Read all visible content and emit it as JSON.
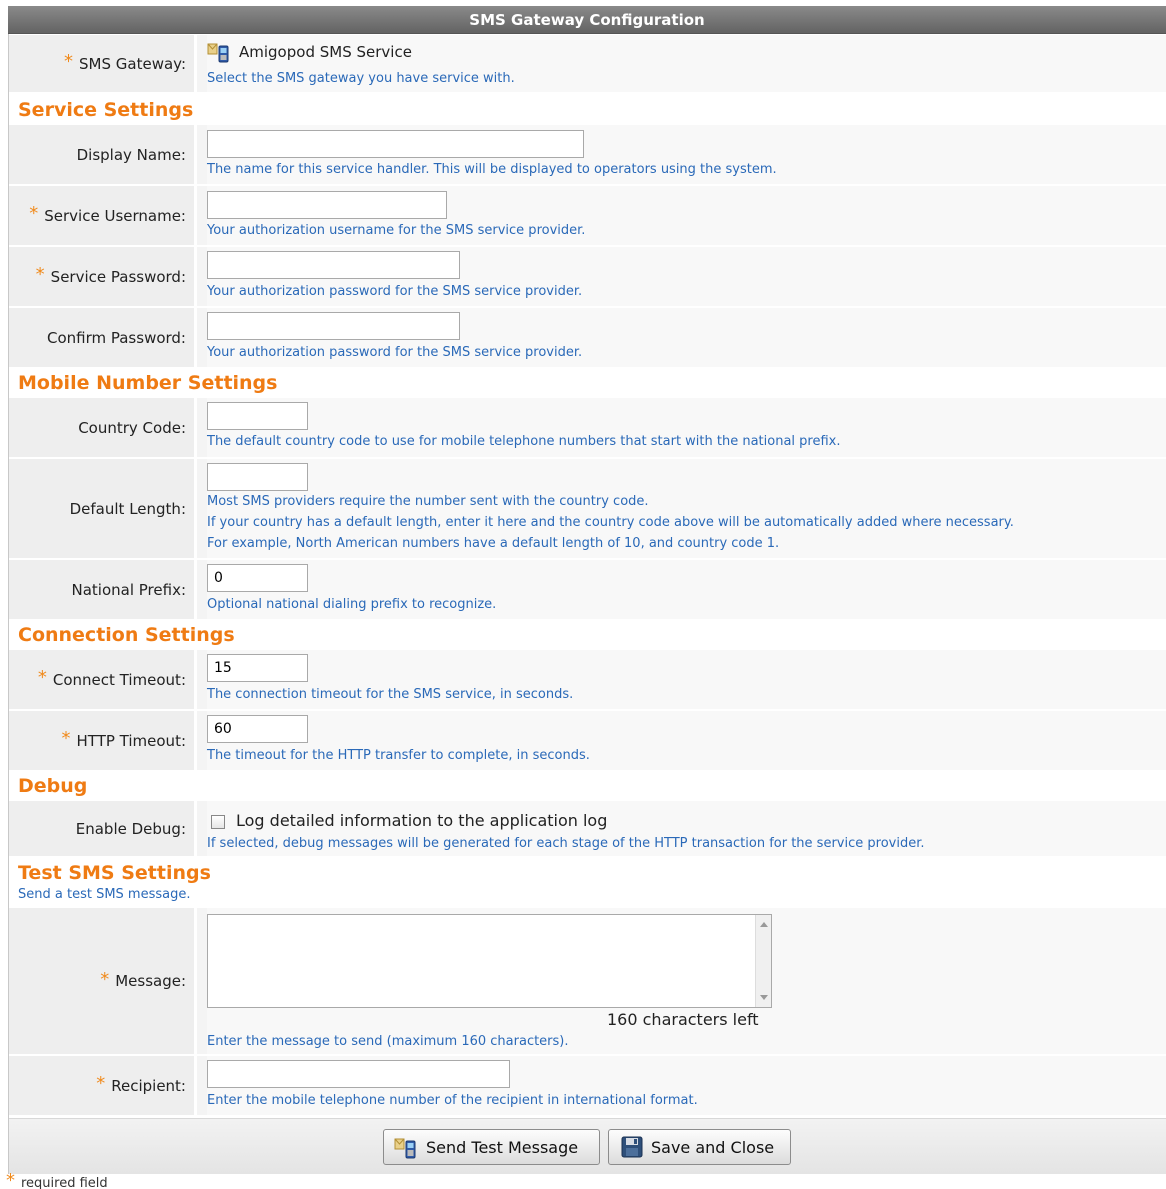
{
  "header": {
    "title": "SMS Gateway Configuration"
  },
  "gateway": {
    "label": "SMS Gateway:",
    "value": "Amigopod SMS Service",
    "help": "Select the SMS gateway you have service with."
  },
  "sections": {
    "service": "Service Settings",
    "mobile": "Mobile Number Settings",
    "connection": "Connection Settings",
    "debug": "Debug",
    "test": "Test SMS Settings",
    "test_sub": "Send a test SMS message."
  },
  "fields": {
    "display_name": {
      "label": "Display Name:",
      "value": "",
      "help": "The name for this service handler. This will be displayed to operators using the system."
    },
    "username": {
      "label": "Service Username:",
      "value": "",
      "help": "Your authorization username for the SMS service provider."
    },
    "password": {
      "label": "Service Password:",
      "value": "",
      "help": "Your authorization password for the SMS service provider."
    },
    "confirm_password": {
      "label": "Confirm Password:",
      "value": "",
      "help": "Your authorization password for the SMS service provider."
    },
    "country_code": {
      "label": "Country Code:",
      "value": "",
      "help": "The default country code to use for mobile telephone numbers that start with the national prefix."
    },
    "default_length": {
      "label": "Default Length:",
      "value": "",
      "help1": "Most SMS providers require the number sent with the country code.",
      "help2": "If your country has a default length, enter it here and the country code above will be automatically added where necessary.",
      "help3": "For example, North American numbers have a default length of 10, and country code 1."
    },
    "national_prefix": {
      "label": "National Prefix:",
      "value": "0",
      "help": "Optional national dialing prefix to recognize."
    },
    "connect_timeout": {
      "label": "Connect Timeout:",
      "value": "15",
      "help": "The connection timeout for the SMS service, in seconds."
    },
    "http_timeout": {
      "label": "HTTP Timeout:",
      "value": "60",
      "help": "The timeout for the HTTP transfer to complete, in seconds."
    },
    "enable_debug": {
      "label": "Enable Debug:",
      "checkbox_label": "Log detailed information to the application log",
      "help": "If selected, debug messages will be generated for each stage of the HTTP transaction for the service provider."
    },
    "message": {
      "label": "Message:",
      "value": "",
      "counter": "160 characters left",
      "help": "Enter the message to send (maximum 160 characters)."
    },
    "recipient": {
      "label": "Recipient:",
      "value": "",
      "help": "Enter the mobile telephone number of the recipient in international format."
    }
  },
  "required_mark": "*",
  "buttons": {
    "send": "Send Test Message",
    "save": "Save and Close"
  },
  "footer": {
    "note": "required field"
  },
  "colors": {
    "accent": "#ef7b13",
    "help": "#2a69b8",
    "title_bg": "#6f6f6f"
  }
}
